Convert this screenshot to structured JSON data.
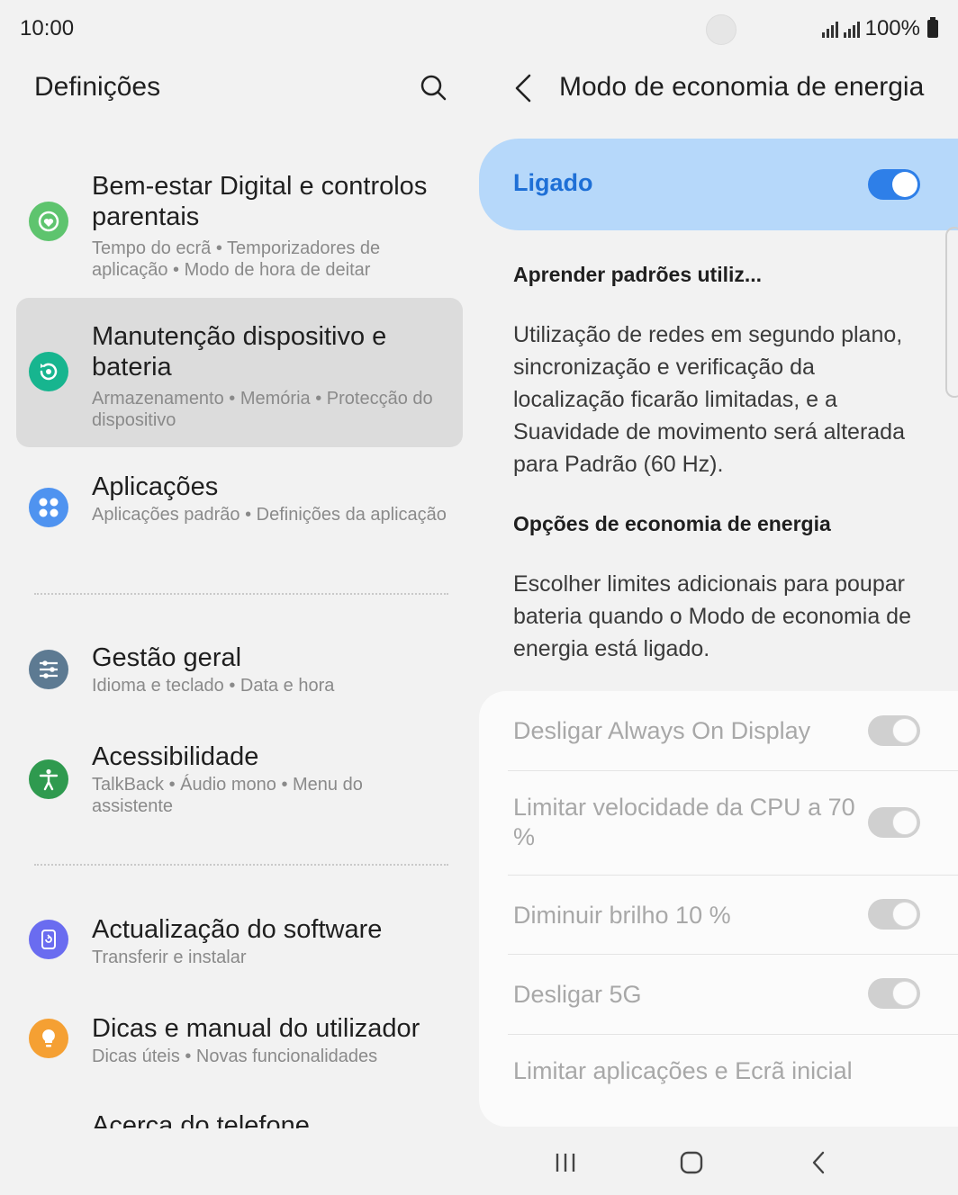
{
  "status_bar": {
    "time": "10:00",
    "battery": "100%"
  },
  "left_pane": {
    "title": "Definições",
    "items": [
      {
        "title": "Bem-estar Digital e controlos parentais",
        "subtitle": "Tempo do ecrã  •  Temporizadores de aplicação  •  Modo de hora de deitar",
        "icon": "digital-wellbeing-icon",
        "color": "#5ec46e"
      },
      {
        "title": "Manutenção dispositivo e bateria",
        "subtitle": "Armazenamento  •  Memória  •  Protecção do dispositivo",
        "icon": "device-care-icon",
        "color": "#17b58f",
        "selected": true
      },
      {
        "title": "Aplicações",
        "subtitle": "Aplicações padrão  •  Definições da aplicação",
        "icon": "apps-icon",
        "color": "#4f93f0"
      },
      {
        "title": "Gestão geral",
        "subtitle": "Idioma e teclado  •  Data e hora",
        "icon": "general-management-icon",
        "color": "#5d7a92"
      },
      {
        "title": "Acessibilidade",
        "subtitle": "TalkBack  •  Áudio mono  •  Menu do assistente",
        "icon": "accessibility-icon",
        "color": "#2f9a4f"
      },
      {
        "title": "Actualização do software",
        "subtitle": "Transferir e instalar",
        "icon": "software-update-icon",
        "color": "#6a6cf0"
      },
      {
        "title": "Dicas e manual do utilizador",
        "subtitle": "Dicas úteis  •  Novas funcionalidades",
        "icon": "tips-icon",
        "color": "#f5a033"
      },
      {
        "title": "Acerca do telefone"
      }
    ]
  },
  "right_pane": {
    "title": "Modo de economia de energia",
    "master_switch": {
      "label": "Ligado",
      "on": true
    },
    "learn_heading": "Aprender padrões utiliz...",
    "learn_body": "Utilização de redes em segundo plano, sincronização e verificação da localização ficarão limitadas, e a Suavidade de movimento será alterada para Padrão (60 Hz).",
    "options_heading": "Opções de economia de energia",
    "options_body": "Escolher limites adicionais para poupar bateria quando o Modo de economia de energia está ligado.",
    "options": [
      {
        "label": "Desligar Always On Display",
        "on": false
      },
      {
        "label": "Limitar velocidade da CPU a 70 %",
        "on": false
      },
      {
        "label": "Diminuir brilho 10 %",
        "on": false
      },
      {
        "label": "Desligar 5G",
        "on": false
      },
      {
        "label": "Limitar aplicações e Ecrã inicial"
      }
    ]
  },
  "colors": {
    "accent": "#2e7fe8",
    "master_bg": "#b6d8fa",
    "master_text": "#1e6fd6"
  }
}
